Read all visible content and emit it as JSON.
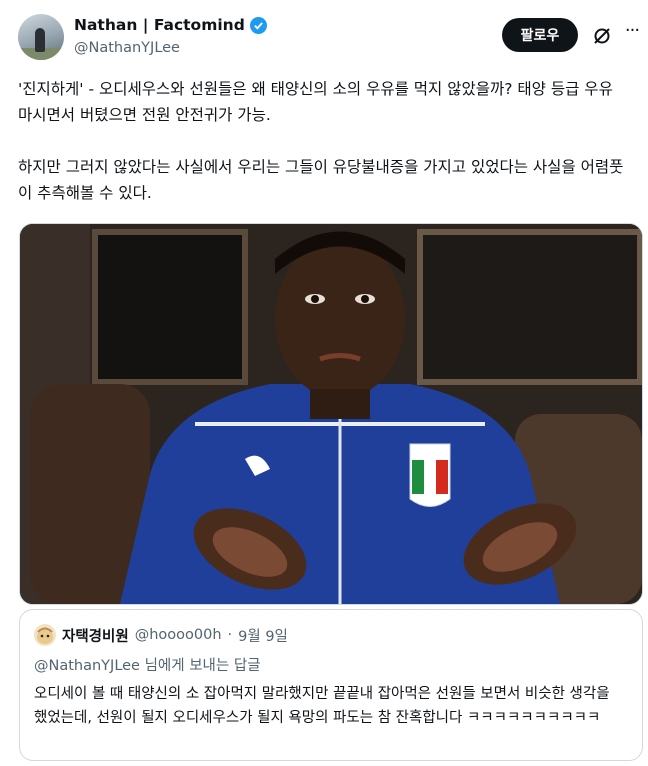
{
  "author": {
    "name": "Nathan | Factomind",
    "handle": "@NathanYJLee",
    "verified_color": "#1d9bf0",
    "avatar_icon": "profile-photo"
  },
  "actions": {
    "follow_label": "팔로우",
    "grok_icon": "grok-icon",
    "more_icon": "more-icon"
  },
  "post": {
    "paragraph1": "'진지하게' - 오디세우스와 선원들은 왜 태양신의 소의 우유를 먹지 않았을까? 태양 등급 우유 마시면서 버텼으면 전원 안전귀가 가능.",
    "paragraph2": "하지만 그러지 않았다는 사실에서 우리는 그들이 유당불내증을 가지고 있었다는 사실을 어렴풋이 추측해볼 수 있다."
  },
  "quote": {
    "name": "자택경비원",
    "handle": "@hoooo00h",
    "separator": "·",
    "date": "9월 9일",
    "reply_to": "@NathanYJLee 님에게 보내는 답글",
    "text": "오디세이 볼 때 태양신의 소 잡아먹지 말라했지만 끝끝내 잡아먹은 선원들 보면서 비슷한 생각을 했었는데, 선원이 될지 오디세우스가 될지 욕망의 파도는 참 잔혹합니다 ㅋㅋㅋㅋㅋㅋㅋㅋㅋㅋ"
  },
  "colors": {
    "text": "#0f1419",
    "secondary": "#536471",
    "border": "#cfd9de",
    "button_bg": "#0f1419",
    "jacket_blue": "#1f3f9a"
  }
}
